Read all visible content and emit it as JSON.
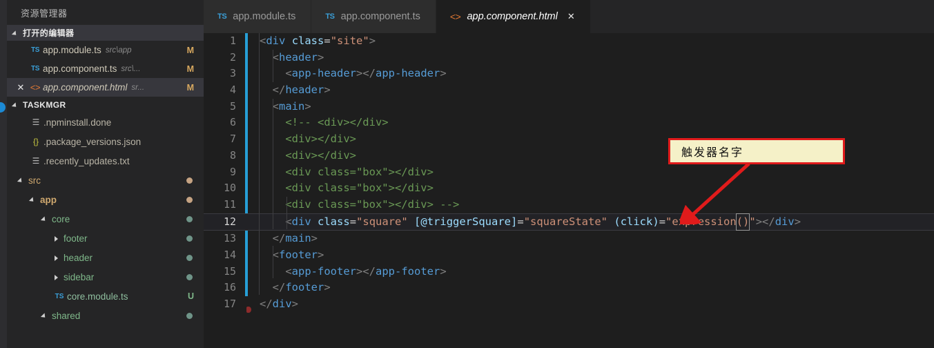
{
  "sidebar": {
    "title": "资源管理器",
    "open_editors": {
      "label": "打开的编辑器",
      "items": [
        {
          "icon": "ts-file-icon",
          "icon_label": "TS",
          "name": "app.module.ts",
          "path": "src\\app",
          "badge": "M",
          "active": false,
          "closable": false
        },
        {
          "icon": "ts-file-icon",
          "icon_label": "TS",
          "name": "app.component.ts",
          "path": "src\\...",
          "badge": "M",
          "active": false,
          "closable": false
        },
        {
          "icon": "html-file-icon",
          "icon_label": "<>",
          "name": "app.component.html",
          "path": "sr...",
          "badge": "M",
          "active": true,
          "closable": true,
          "close_label": "✕"
        }
      ]
    },
    "workspace": {
      "label": "TASKMGR",
      "items": [
        {
          "name": ".npminstall.done",
          "icon": "txt-file-icon",
          "icon_label": "☰",
          "depth": 1,
          "kind": "file",
          "dot": "",
          "badge": ""
        },
        {
          "name": ".package_versions.json",
          "icon": "json-file-icon",
          "icon_label": "{}",
          "depth": 1,
          "kind": "file",
          "dot": "",
          "badge": ""
        },
        {
          "name": ".recently_updates.txt",
          "icon": "txt-file-icon",
          "icon_label": "☰",
          "depth": 1,
          "kind": "file",
          "dot": "",
          "badge": ""
        },
        {
          "name": "src",
          "icon": "chevron-down-icon",
          "icon_label": "",
          "depth": 0,
          "kind": "folder-open",
          "dot": "#c5a383",
          "badge": ""
        },
        {
          "name": "app",
          "icon": "chevron-down-icon",
          "icon_label": "",
          "depth": 1,
          "kind": "folder-open",
          "dot": "#c5a383",
          "badge": ""
        },
        {
          "name": "core",
          "icon": "chevron-down-icon",
          "icon_label": "",
          "depth": 2,
          "kind": "folder-open",
          "dot": "#6f9488",
          "badge": ""
        },
        {
          "name": "footer",
          "icon": "chevron-right-icon",
          "icon_label": "",
          "depth": 3,
          "kind": "folder",
          "dot": "#6f9488",
          "badge": ""
        },
        {
          "name": "header",
          "icon": "chevron-right-icon",
          "icon_label": "",
          "depth": 3,
          "kind": "folder",
          "dot": "#6f9488",
          "badge": ""
        },
        {
          "name": "sidebar",
          "icon": "chevron-right-icon",
          "icon_label": "",
          "depth": 3,
          "kind": "folder",
          "dot": "#6f9488",
          "badge": ""
        },
        {
          "name": "core.module.ts",
          "icon": "ts-file-icon",
          "icon_label": "TS",
          "depth": 3,
          "kind": "file",
          "dot": "",
          "badge": "U"
        },
        {
          "name": "shared",
          "icon": "chevron-down-icon",
          "icon_label": "",
          "depth": 2,
          "kind": "folder-open",
          "dot": "#6f9488",
          "badge": ""
        }
      ]
    }
  },
  "tabs": [
    {
      "icon": "ts-file-icon",
      "icon_label": "TS",
      "label": "app.module.ts",
      "active": false,
      "closable": false,
      "close_label": ""
    },
    {
      "icon": "ts-file-icon",
      "icon_label": "TS",
      "label": "app.component.ts",
      "active": false,
      "closable": false,
      "close_label": ""
    },
    {
      "icon": "html-file-icon",
      "icon_label": "<>",
      "label": "app.component.html",
      "active": true,
      "closable": true,
      "close_label": "✕"
    }
  ],
  "editor": {
    "active_line": 12,
    "lines": [
      {
        "n": "1",
        "tokens": [
          {
            "t": "punc",
            "v": "<"
          },
          {
            "t": "tag",
            "v": "div"
          },
          {
            "t": "plain",
            "v": " "
          },
          {
            "t": "attr",
            "v": "class"
          },
          {
            "t": "plain",
            "v": "="
          },
          {
            "t": "str",
            "v": "\"site\""
          },
          {
            "t": "punc",
            "v": ">"
          }
        ],
        "indent": 0
      },
      {
        "n": "2",
        "tokens": [
          {
            "t": "punc",
            "v": "  <"
          },
          {
            "t": "tag",
            "v": "header"
          },
          {
            "t": "punc",
            "v": ">"
          }
        ],
        "indent": 1
      },
      {
        "n": "3",
        "tokens": [
          {
            "t": "punc",
            "v": "    <"
          },
          {
            "t": "tag",
            "v": "app-header"
          },
          {
            "t": "punc",
            "v": "></"
          },
          {
            "t": "tag",
            "v": "app-header"
          },
          {
            "t": "punc",
            "v": ">"
          }
        ],
        "indent": 2
      },
      {
        "n": "4",
        "tokens": [
          {
            "t": "punc",
            "v": "  </"
          },
          {
            "t": "tag",
            "v": "header"
          },
          {
            "t": "punc",
            "v": ">"
          }
        ],
        "indent": 1
      },
      {
        "n": "5",
        "tokens": [
          {
            "t": "punc",
            "v": "  <"
          },
          {
            "t": "tag",
            "v": "main"
          },
          {
            "t": "punc",
            "v": ">"
          }
        ],
        "indent": 1
      },
      {
        "n": "6",
        "tokens": [
          {
            "t": "cmt",
            "v": "    <!-- <div></div>"
          }
        ],
        "indent": 2
      },
      {
        "n": "7",
        "tokens": [
          {
            "t": "cmt",
            "v": "    <div></div>"
          }
        ],
        "indent": 2
      },
      {
        "n": "8",
        "tokens": [
          {
            "t": "cmt",
            "v": "    <div></div>"
          }
        ],
        "indent": 2
      },
      {
        "n": "9",
        "tokens": [
          {
            "t": "cmt",
            "v": "    <div class=\"box\"></div>"
          }
        ],
        "indent": 2
      },
      {
        "n": "10",
        "tokens": [
          {
            "t": "cmt",
            "v": "    <div class=\"box\"></div>"
          }
        ],
        "indent": 2
      },
      {
        "n": "11",
        "tokens": [
          {
            "t": "cmt",
            "v": "    <div class=\"box\"></div> -->"
          }
        ],
        "indent": 2
      },
      {
        "n": "12",
        "tokens": [
          {
            "t": "punc",
            "v": "    <"
          },
          {
            "t": "tag",
            "v": "div"
          },
          {
            "t": "plain",
            "v": " "
          },
          {
            "t": "attr",
            "v": "class"
          },
          {
            "t": "plain",
            "v": "="
          },
          {
            "t": "str",
            "v": "\"square\""
          },
          {
            "t": "plain",
            "v": " "
          },
          {
            "t": "attr",
            "v": "[@triggerSquare]"
          },
          {
            "t": "plain",
            "v": "="
          },
          {
            "t": "str",
            "v": "\"squareState\""
          },
          {
            "t": "plain",
            "v": " "
          },
          {
            "t": "attr",
            "v": "(click)"
          },
          {
            "t": "plain",
            "v": "="
          },
          {
            "t": "str",
            "v": "\"expression"
          },
          {
            "t": "cursor",
            "v": "()"
          },
          {
            "t": "str",
            "v": "\""
          },
          {
            "t": "punc",
            "v": "></"
          },
          {
            "t": "tag",
            "v": "div"
          },
          {
            "t": "punc",
            "v": ">"
          }
        ],
        "indent": 2
      },
      {
        "n": "13",
        "tokens": [
          {
            "t": "punc",
            "v": "  </"
          },
          {
            "t": "tag",
            "v": "main"
          },
          {
            "t": "punc",
            "v": ">"
          }
        ],
        "indent": 1
      },
      {
        "n": "14",
        "tokens": [
          {
            "t": "punc",
            "v": "  <"
          },
          {
            "t": "tag",
            "v": "footer"
          },
          {
            "t": "punc",
            "v": ">"
          }
        ],
        "indent": 1
      },
      {
        "n": "15",
        "tokens": [
          {
            "t": "punc",
            "v": "    <"
          },
          {
            "t": "tag",
            "v": "app-footer"
          },
          {
            "t": "punc",
            "v": "></"
          },
          {
            "t": "tag",
            "v": "app-footer"
          },
          {
            "t": "punc",
            "v": ">"
          }
        ],
        "indent": 2
      },
      {
        "n": "16",
        "tokens": [
          {
            "t": "punc",
            "v": "  </"
          },
          {
            "t": "tag",
            "v": "footer"
          },
          {
            "t": "punc",
            "v": ">"
          }
        ],
        "indent": 1
      },
      {
        "n": "17",
        "tokens": [
          {
            "t": "punc",
            "v": "</"
          },
          {
            "t": "tag",
            "v": "div"
          },
          {
            "t": "punc",
            "v": ">"
          }
        ],
        "indent": 0
      }
    ]
  },
  "annotation": {
    "text": "触发器名字",
    "background": "#f5f1c8",
    "border_color": "#e01b1b",
    "arrow_color": "#e01b1b"
  },
  "colors": {
    "accent_blue": "#1c8ad4",
    "fold_bar": "#279fd6",
    "modified_badge": "#d7a85f",
    "untracked_badge": "#7fb88a"
  }
}
